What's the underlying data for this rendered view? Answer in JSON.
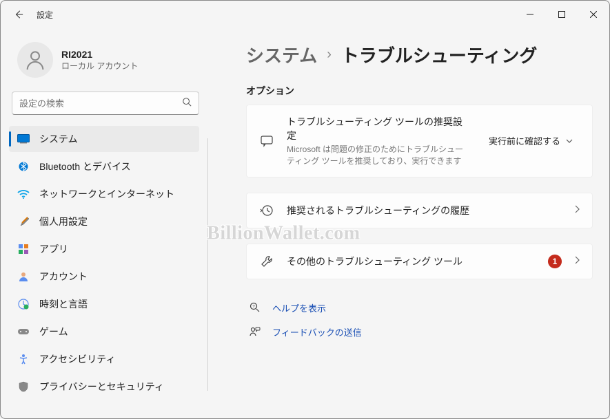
{
  "window": {
    "title": "設定"
  },
  "user": {
    "name": "RI2021",
    "sub": "ローカル アカウント"
  },
  "search": {
    "placeholder": "設定の検索"
  },
  "nav": {
    "items": [
      {
        "label": "システム"
      },
      {
        "label": "Bluetooth とデバイス"
      },
      {
        "label": "ネットワークとインターネット"
      },
      {
        "label": "個人用設定"
      },
      {
        "label": "アプリ"
      },
      {
        "label": "アカウント"
      },
      {
        "label": "時刻と言語"
      },
      {
        "label": "ゲーム"
      },
      {
        "label": "アクセシビリティ"
      },
      {
        "label": "プライバシーとセキュリティ"
      }
    ]
  },
  "breadcrumb": {
    "parent": "システム",
    "current": "トラブルシューティング"
  },
  "section": {
    "options": "オプション"
  },
  "cards": {
    "recommended": {
      "title": "トラブルシューティング ツールの推奨設定",
      "sub": "Microsoft は問題の修正のためにトラブルシューティング ツールを推奨しており、実行できます",
      "dropdown": "実行前に確認する"
    },
    "history": {
      "title": "推奨されるトラブルシューティングの履歴"
    },
    "other": {
      "title": "その他のトラブルシューティング ツール",
      "badge": "1"
    }
  },
  "links": {
    "help": "ヘルプを表示",
    "feedback": "フィードバックの送信"
  },
  "watermark": "BillionWallet.com"
}
